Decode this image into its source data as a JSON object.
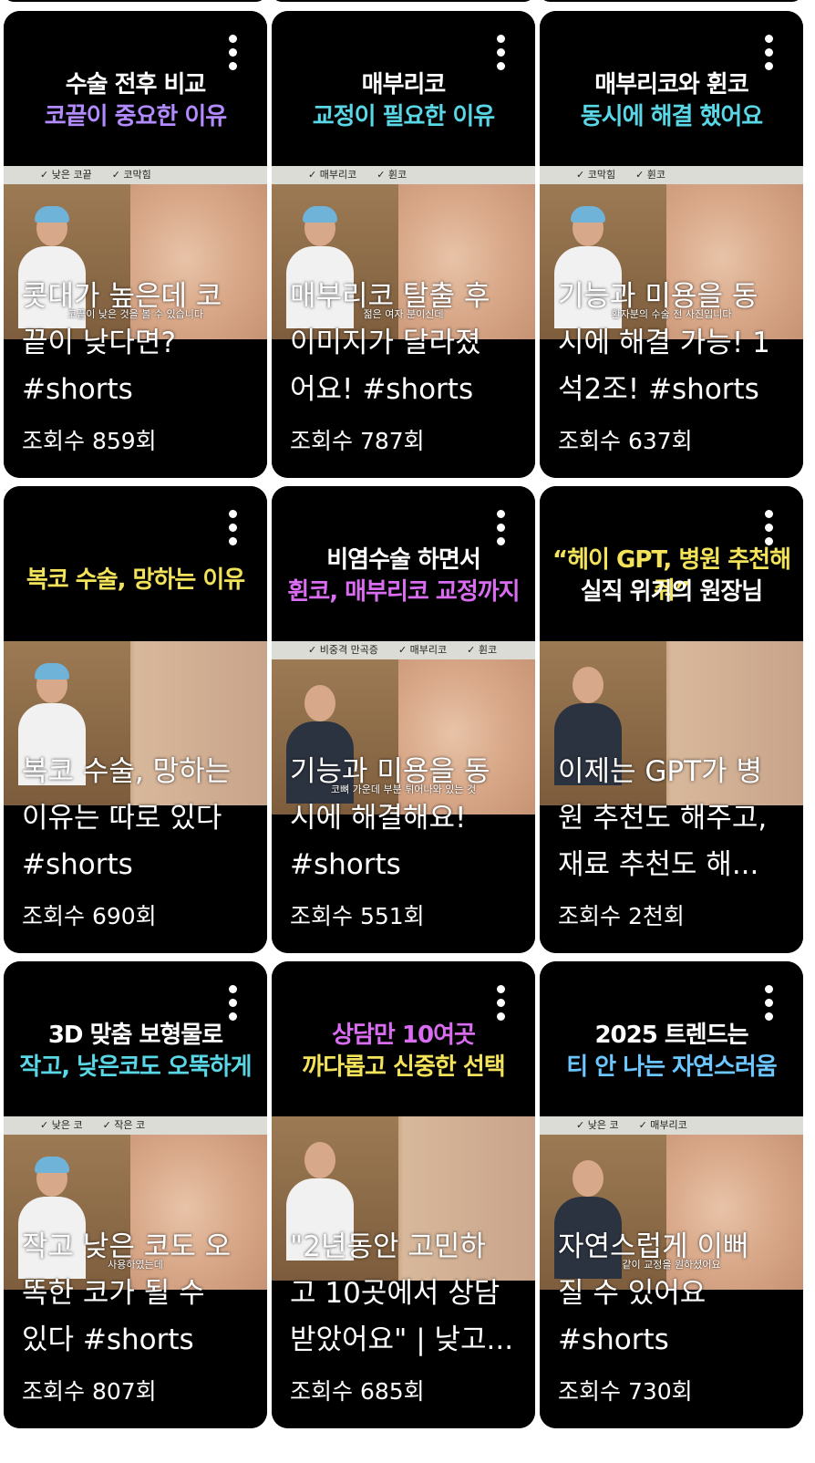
{
  "colors": {
    "card_bg": "#000000",
    "text": "#ffffff",
    "purple": "#b28cff",
    "cyan": "#59d7e6",
    "yellow": "#f3e35a",
    "magenta": "#d96cf0",
    "blue": "#6cc6ff"
  },
  "icons": {
    "more": "more-vert-icon"
  },
  "cards": [
    {
      "headline": [
        "수술 전후 비교",
        "코끝이 중요한 이유"
      ],
      "headline_colors": [
        "#ffffff",
        "#b28cff"
      ],
      "checks": [
        "✓ 낮은 코끝",
        "✓ 코막힘"
      ],
      "caption": "코끝이 낮은 것을 볼 수 있습니다",
      "title": "콧대가 높은데 코\n끝이 낮다면?\n#shorts",
      "views": "조회수 859회"
    },
    {
      "headline": [
        "매부리코",
        "교정이 필요한 이유"
      ],
      "headline_colors": [
        "#ffffff",
        "#59d7e6"
      ],
      "checks": [
        "✓ 매부리코",
        "✓ 휜코"
      ],
      "caption": "젊은 여자 분이신데",
      "title": "매부리코 탈출 후\n이미지가 달라졌\n어요! #shorts",
      "views": "조회수 787회"
    },
    {
      "headline": [
        "매부리코와 휜코",
        "동시에 해결 했어요"
      ],
      "headline_colors": [
        "#ffffff",
        "#59d7e6"
      ],
      "checks": [
        "✓ 코막힘",
        "✓ 휜코"
      ],
      "caption": "환자분의 수술 전 사진입니다",
      "title": "기능과 미용을 동\n시에 해결 가능! 1\n석2조! #shorts",
      "views": "조회수 637회"
    },
    {
      "headline": [
        "복코 수술, 망하는 이유"
      ],
      "headline_colors": [
        "#f3e35a"
      ],
      "checks": [],
      "caption": "",
      "title": "복코 수술, 망하는\n이유는 따로 있다\n#shorts",
      "views": "조회수 690회"
    },
    {
      "headline": [
        "비염수술 하면서",
        "휜코, 매부리코 교정까지"
      ],
      "headline_colors": [
        "#ffffff",
        "#d96cf0"
      ],
      "checks": [
        "✓ 비중격 만곡증",
        "✓ 매부리코",
        "✓ 휜코"
      ],
      "caption": "코뼈 가운데 부분 튀어나와 있는 것",
      "title": "기능과 미용을 동\n시에 해결해요!\n#shorts",
      "views": "조회수 551회"
    },
    {
      "headline": [
        "“헤이 GPT, 병원 추천해줘”",
        "실직 위기의 원장님"
      ],
      "headline_colors": [
        "#f3e35a",
        "#ffffff"
      ],
      "checks": [],
      "caption": "",
      "title": "이제는 GPT가 병\n원 추천도 해주고,\n재료 추천도 해...",
      "views": "조회수 2천회"
    },
    {
      "headline": [
        "3D 맞춤 보형물로",
        "작고, 낮은코도 오뚝하게"
      ],
      "headline_colors": [
        "#ffffff",
        "#59d7e6"
      ],
      "checks": [
        "✓ 낮은 코",
        "✓ 작은 코"
      ],
      "caption": "사용하였는데",
      "title": "작고 낮은 코도 오\n똑한 코가 될 수\n있다 #shorts",
      "views": "조회수 807회"
    },
    {
      "headline": [
        "상담만 10여곳",
        "까다롭고 신중한 선택"
      ],
      "headline_colors": [
        "#d96cf0",
        "#f3e35a"
      ],
      "checks": [],
      "caption": "",
      "title": "\"2년동안 고민하\n고 10곳에서 상담\n받았어요\" | 낮고...",
      "views": "조회수 685회"
    },
    {
      "headline": [
        "2025 트렌드는",
        "티 안 나는 자연스러움"
      ],
      "headline_colors": [
        "#ffffff",
        "#6cc6ff"
      ],
      "checks": [
        "✓ 낮은 코",
        "✓ 매부리코"
      ],
      "caption": "같이 교정을 원하셨어요",
      "title": "자연스럽게 이뻐\n질 수 있어요\n#shorts",
      "views": "조회수 730회"
    }
  ]
}
